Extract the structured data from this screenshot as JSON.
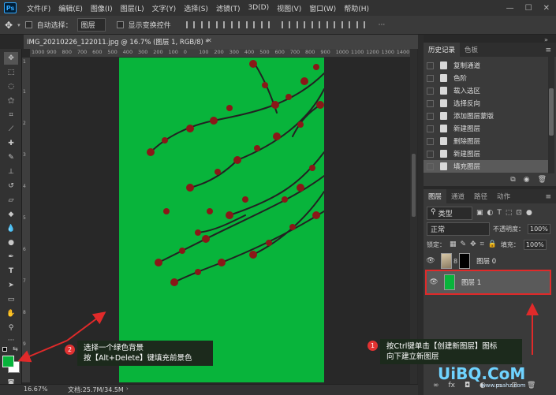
{
  "app": {
    "logo": "Ps"
  },
  "menu": [
    "文件(F)",
    "编辑(E)",
    "图像(I)",
    "图层(L)",
    "文字(Y)",
    "选择(S)",
    "滤镜(T)",
    "3D(D)",
    "视图(V)",
    "窗口(W)",
    "帮助(H)"
  ],
  "options": {
    "auto_select_label": "自动选择：",
    "auto_select_value": "图层",
    "show_transform_label": "显示变换控件"
  },
  "document": {
    "tab_title": "IMG_20210226_122011.jpg @ 16.7% (图层 1, RGB/8) *",
    "canvas_color": "#08b43b"
  },
  "ruler": {
    "top": [
      "1000",
      "900",
      "800",
      "700",
      "600",
      "500",
      "400",
      "300",
      "200",
      "100",
      "0",
      "100",
      "200",
      "300",
      "400",
      "500",
      "600",
      "700",
      "800",
      "900",
      "1000",
      "1100",
      "1200",
      "1300",
      "1400"
    ]
  },
  "status": {
    "zoom": "16.67%",
    "doc_info": "文档:25.7M/34.5M"
  },
  "history_panel": {
    "tabs": [
      "历史记录",
      "色板"
    ],
    "items": [
      "复制通道",
      "色阶",
      "载入选区",
      "选择反向",
      "添加图层蒙版",
      "新建图层",
      "删除图层",
      "新建图层",
      "填充图层"
    ],
    "selected_index": 8
  },
  "layers_panel": {
    "tabs": [
      "图层",
      "通道",
      "路径",
      "动作"
    ],
    "filter_label": "类型",
    "blend_mode": "正常",
    "opacity_label": "不透明度：",
    "opacity_value": "100%",
    "lock_label": "锁定：",
    "fill_label": "填充：",
    "fill_value": "100%",
    "layers": [
      {
        "name": "图层 0",
        "selected": false
      },
      {
        "name": "图层 1",
        "selected": true,
        "color": "#08b43b"
      }
    ]
  },
  "callouts": [
    {
      "number": "2",
      "lines": [
        "选择一个绿色背景",
        "按【Alt+Delete】键填充前景色"
      ]
    },
    {
      "number": "1",
      "lines": [
        "按Ctrl键单击【创建新图层】图标",
        "向下建立新图层"
      ]
    }
  ],
  "watermark": {
    "text": "UiBQ.CoM",
    "sub": "www.psahz.com"
  },
  "colors": {
    "foreground": "#08b43b",
    "background": "#ffffff",
    "accent_red": "#e02a2a"
  }
}
